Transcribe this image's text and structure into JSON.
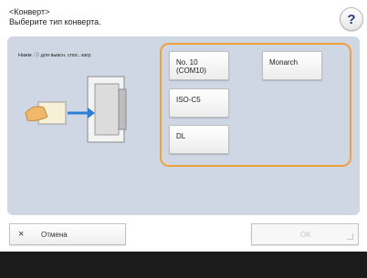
{
  "header": {
    "title_line1": "<Конверт>",
    "title_line2": "Выберите тип конверта.",
    "help_label": "?"
  },
  "panel": {
    "hint": "Нажм. ⓘ для вывсн. спос. загр.",
    "options": [
      {
        "label": "No. 10 (COM10)"
      },
      {
        "label": "Monarch"
      },
      {
        "label": "ISO-C5"
      },
      {
        "label": "DL"
      }
    ]
  },
  "footer": {
    "cancel_icon": "×",
    "cancel_label": "Отмена",
    "ok_label": "OK"
  },
  "colors": {
    "panel_bg": "#cfd7e5",
    "highlight": "#f0a23a",
    "arrow": "#2e7fd6",
    "bottom_bar": "#1b1b1b"
  },
  "icons": [
    "help-icon",
    "cancel-x-icon",
    "envelope-feed-illustration"
  ]
}
